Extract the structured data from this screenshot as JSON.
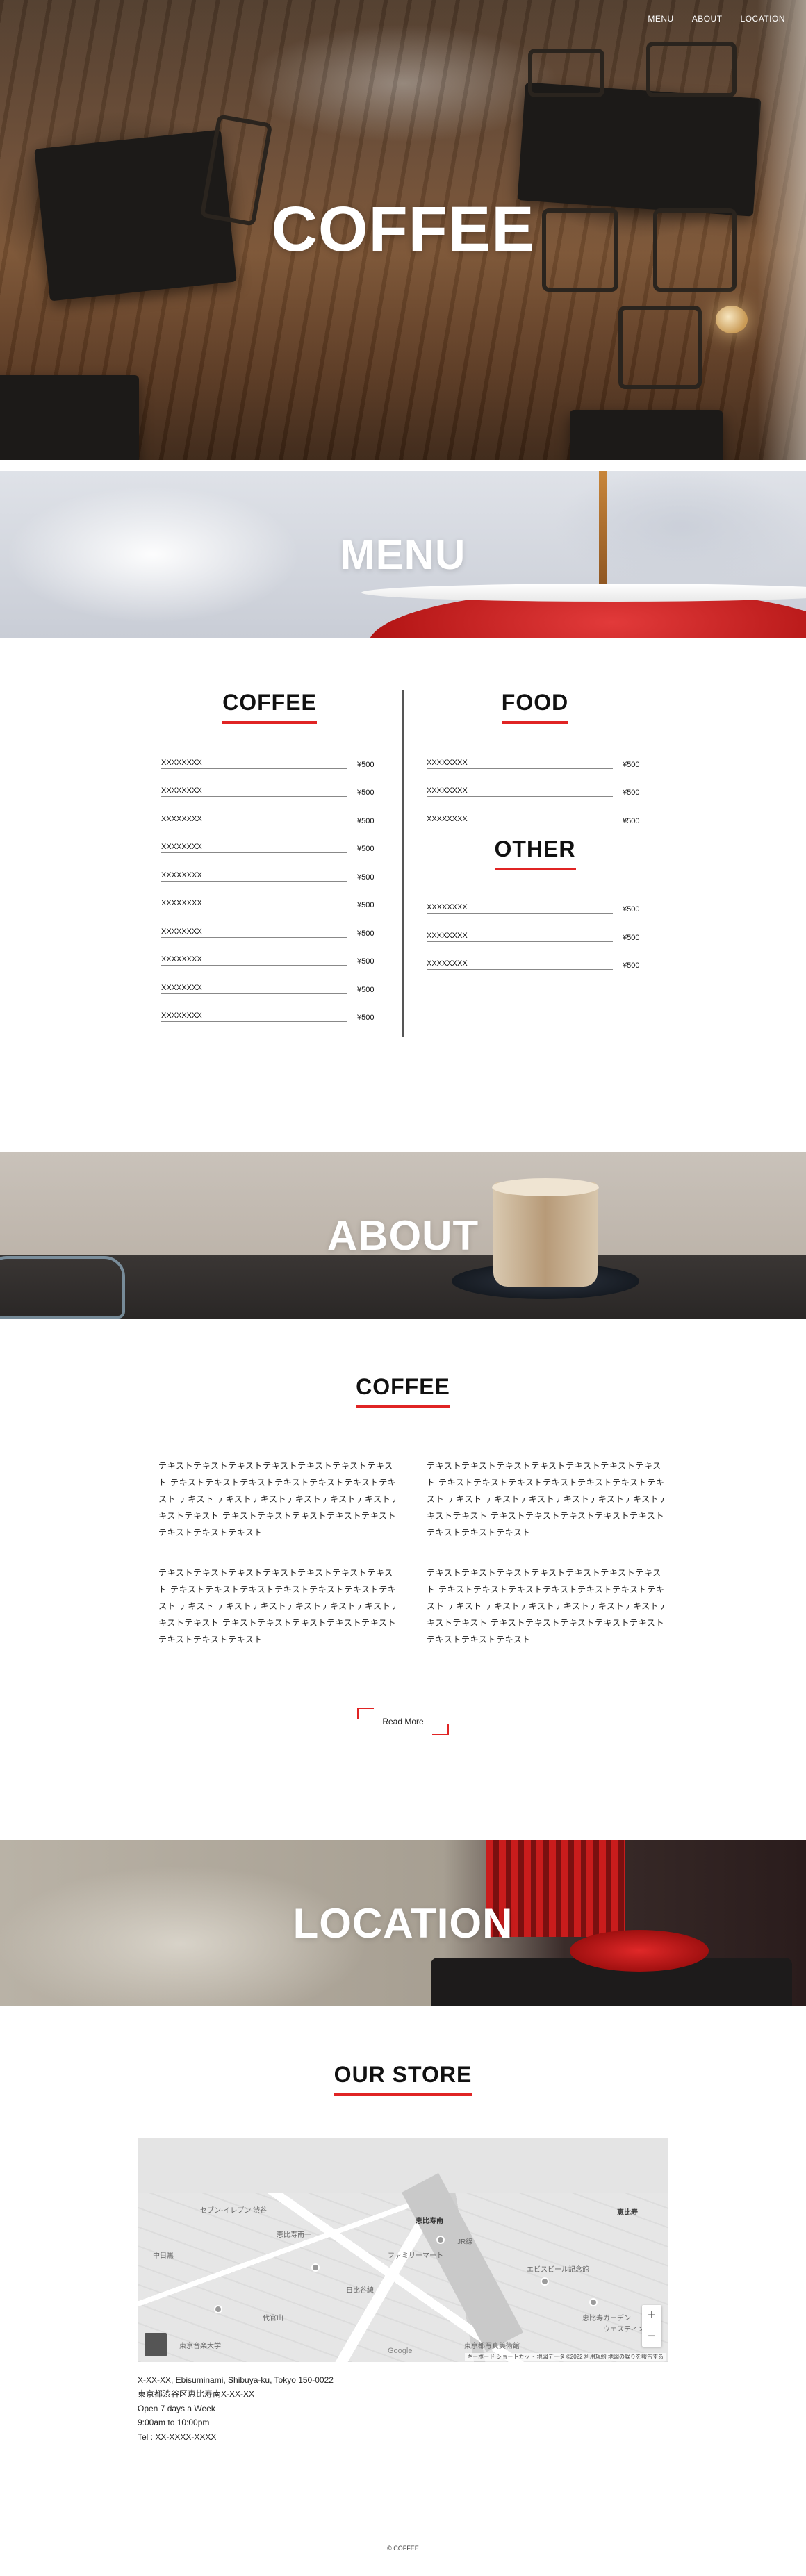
{
  "nav": {
    "items": [
      "MENU",
      "ABOUT",
      "LOCATION"
    ]
  },
  "hero": {
    "title": "COFFEE"
  },
  "sections": {
    "menu_banner": "MENU",
    "about_banner": "ABOUT",
    "location_banner": "LOCATION"
  },
  "menu": {
    "coffee": {
      "title": "COFFEE",
      "items": [
        {
          "name": "XXXXXXXX",
          "price": "¥500"
        },
        {
          "name": "XXXXXXXX",
          "price": "¥500"
        },
        {
          "name": "XXXXXXXX",
          "price": "¥500"
        },
        {
          "name": "XXXXXXXX",
          "price": "¥500"
        },
        {
          "name": "XXXXXXXX",
          "price": "¥500"
        },
        {
          "name": "XXXXXXXX",
          "price": "¥500"
        },
        {
          "name": "XXXXXXXX",
          "price": "¥500"
        },
        {
          "name": "XXXXXXXX",
          "price": "¥500"
        },
        {
          "name": "XXXXXXXX",
          "price": "¥500"
        },
        {
          "name": "XXXXXXXX",
          "price": "¥500"
        }
      ]
    },
    "food": {
      "title": "FOOD",
      "items": [
        {
          "name": "XXXXXXXX",
          "price": "¥500"
        },
        {
          "name": "XXXXXXXX",
          "price": "¥500"
        },
        {
          "name": "XXXXXXXX",
          "price": "¥500"
        }
      ]
    },
    "other": {
      "title": "OTHER",
      "items": [
        {
          "name": "XXXXXXXX",
          "price": "¥500"
        },
        {
          "name": "XXXXXXXX",
          "price": "¥500"
        },
        {
          "name": "XXXXXXXX",
          "price": "¥500"
        }
      ]
    }
  },
  "about": {
    "title": "COFFEE",
    "paragraphs": [
      "テキストテキストテキストテキストテキストテキストテキスト テキストテキストテキストテキストテキストテキストテキスト テキスト テキストテキストテキストテキストテキストテキストテキスト テキストテキストテキストテキストテキストテキストテキストテキスト",
      "テキストテキストテキストテキストテキストテキストテキスト テキストテキストテキストテキストテキストテキストテキスト テキスト テキストテキストテキストテキストテキストテキストテキスト テキストテキストテキストテキストテキストテキストテキストテキスト",
      "テキストテキストテキストテキストテキストテキストテキスト テキストテキストテキストテキストテキストテキストテキスト テキスト テキストテキストテキストテキストテキストテキストテキスト テキストテキストテキストテキストテキストテキストテキストテキスト",
      "テキストテキストテキストテキストテキストテキストテキスト テキストテキストテキストテキストテキストテキストテキスト テキスト テキストテキストテキストテキストテキストテキストテキスト テキストテキストテキストテキストテキストテキストテキストテキスト"
    ],
    "read_more": "Read More"
  },
  "store": {
    "title": "OUR STORE",
    "map": {
      "labels": [
        "セブン-イレブン 渋谷",
        "恵比寿南",
        "恵比寿",
        "ファミリーマート",
        "エビスビール記念館",
        "東京都写真美術館",
        "恵比寿ガーデン",
        "ウェスティン",
        "日比谷線",
        "JR線",
        "中目黒",
        "恵比寿南一",
        "代官山",
        "東京音楽大学"
      ],
      "google": "Google",
      "attribution": "キーボード ショートカット   地図データ ©2022   利用規約   地図の誤りを報告する",
      "zoom_in": "+",
      "zoom_out": "−"
    },
    "address_en": "X-XX-XX, Ebisuminami, Shibuya-ku, Tokyo 150-0022",
    "address_ja": "東京都渋谷区恵比寿南X-XX-XX",
    "open": "Open 7 days a Week",
    "hours": "9:00am to 10:00pm",
    "tel": "Tel : XX-XXXX-XXXX"
  },
  "footer": {
    "copyright": "© COFFEE"
  },
  "colors": {
    "accent": "#e02424",
    "text": "#111111"
  }
}
